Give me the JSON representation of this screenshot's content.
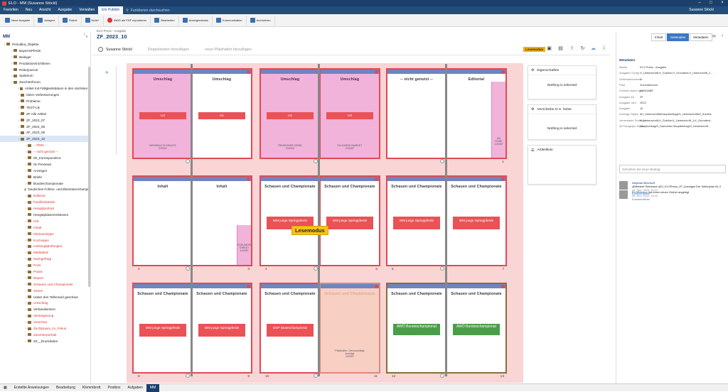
{
  "window": {
    "title": "ELO - MM (Susanne Stöckl)"
  },
  "menu": {
    "items": [
      "Favoriten",
      "Neu",
      "Ansicht",
      "Ausgabe",
      "Verwalten",
      "Elo Publish"
    ],
    "active": "Elo Publish",
    "search_placeholder": "Funktionen durchsuchen",
    "user": "Susanne Stöckl"
  },
  "ribbon": {
    "groups": [
      {
        "label": "Neue Ausgabe"
      },
      {
        "label": "Anlagen"
      },
      {
        "label": "Rubrik"
      },
      {
        "label": "Notiz+"
      },
      {
        "label": "INDD als PDF exportieren"
      },
      {
        "label": "Bearbeiten"
      },
      {
        "label": "Anzeigenstatus"
      },
      {
        "label": "Kommunikation"
      },
      {
        "label": "Archivieren"
      }
    ]
  },
  "left_panel": {
    "header": "MM",
    "tree": [
      {
        "label": "Periodika_Objekte",
        "red": false,
        "sel": false
      },
      {
        "label": "BayernsPferde",
        "red": false,
        "sel": false
      },
      {
        "label": "Beileger",
        "red": false,
        "sel": false
      },
      {
        "label": "Produktionsrichtlinien",
        "red": false,
        "sel": false
      },
      {
        "label": "Reiterjournal",
        "red": false,
        "sel": false
      },
      {
        "label": "Spektrum",
        "red": false,
        "sel": false
      },
      {
        "label": "Zuechterforum",
        "red": false,
        "sel": false
      },
      {
        "label": "Artikel mit Fälligkeitsdatum in den nächsten 2",
        "red": false,
        "sel": false
      },
      {
        "label": "Ideen Verbesserungen",
        "red": false,
        "sel": false
      },
      {
        "label": "Probleme",
        "red": false,
        "sel": false
      },
      {
        "label": "TEST-LB",
        "red": false,
        "sel": false
      },
      {
        "label": "ZF Alle Artikel",
        "red": false,
        "sel": false
      },
      {
        "label": "ZF_2023_07",
        "red": false,
        "sel": false
      },
      {
        "label": "ZF_2023_08",
        "red": false,
        "sel": false
      },
      {
        "label": "ZF_2023_09",
        "red": false,
        "sel": false
      },
      {
        "label": "ZF_2023_10",
        "red": false,
        "sel": true
      },
      {
        "label": "-- FREI --",
        "red": true,
        "sel": false
      },
      {
        "label": "-- nicht genutzt --",
        "red": true,
        "sel": false
      },
      {
        "label": "00_Korrespondenz",
        "red": false,
        "sel": false
      },
      {
        "label": "01-Previews",
        "red": false,
        "sel": false
      },
      {
        "label": "Anzeigen",
        "red": false,
        "sel": false
      },
      {
        "label": "Briefe",
        "red": false,
        "sel": false
      },
      {
        "label": "Bundeschampionate",
        "red": false,
        "sel": false
      },
      {
        "label": "Deutsches Fohlen- und Elitestutenchampio",
        "red": false,
        "sel": false
      },
      {
        "label": "Editorial",
        "red": true,
        "sel": false
      },
      {
        "label": "Familienbande",
        "red": true,
        "sel": false
      },
      {
        "label": "Hengstportrait",
        "red": true,
        "sel": false
      },
      {
        "label": "Hengstplatzierenktionen",
        "red": false,
        "sel": false
      },
      {
        "label": "HIS",
        "red": true,
        "sel": false
      },
      {
        "label": "Inhalt",
        "red": true,
        "sel": false
      },
      {
        "label": "Kleinanzeigen",
        "red": true,
        "sel": false
      },
      {
        "label": "Kurzvogen",
        "red": true,
        "sel": false
      },
      {
        "label": "Leistungsprüfungen",
        "red": true,
        "sel": false
      },
      {
        "label": "Marktplatz",
        "red": true,
        "sel": false
      },
      {
        "label": "Nachgefragt",
        "red": true,
        "sel": false
      },
      {
        "label": "Porsi",
        "red": true,
        "sel": false
      },
      {
        "label": "Praxis",
        "red": true,
        "sel": false
      },
      {
        "label": "Report",
        "red": true,
        "sel": false
      },
      {
        "label": "Schauen und Championate",
        "red": true,
        "sel": false
      },
      {
        "label": "Szene",
        "red": true,
        "sel": false
      },
      {
        "label": "Ueber den Tellerrand geschaut",
        "red": false,
        "sel": false
      },
      {
        "label": "Umschlag",
        "red": true,
        "sel": false
      },
      {
        "label": "Verbandsintern",
        "red": false,
        "sel": false
      },
      {
        "label": "Versteigerung",
        "red": true,
        "sel": false
      },
      {
        "label": "Vorschau",
        "red": true,
        "sel": false
      },
      {
        "label": "Zuchtpraxis_im_Fokus",
        "red": true,
        "sel": false
      },
      {
        "label": "Zuechterportrait",
        "red": true,
        "sel": false
      },
      {
        "label": "ZZ__Druckdaten",
        "red": false,
        "sel": false
      }
    ]
  },
  "main": {
    "breadcrumb": "ELO Press - Ausgabe",
    "title": "ZF_2023_10",
    "user": "Susanne Stöckl",
    "dropdown1": "Doppelseiten hinzufügen",
    "dropdown2": "neue Platzhalter hinzufügen",
    "lesemodus_badge": "Lesemodus",
    "lesemodus_label": "Lesemodus"
  },
  "pages": {
    "p1a": {
      "title": "Umschlag",
      "box": "U4",
      "mini": "WEIHRAUCH KRAUTE\n2/4/287"
    },
    "p1b": {
      "title": "Umschlag",
      "box": "U1"
    },
    "p2a": {
      "title": "Umschlag",
      "box": "U2",
      "mini": "TRAKEHNER VEREL\n2/4/430"
    },
    "p2b": {
      "title": "Umschlag",
      "box": "U3",
      "mini": "EN GARDE MARKET\n2/4/287"
    },
    "p3a": {
      "title": "-- nicht genutzt --"
    },
    "p3b": {
      "title": "Editorial",
      "mini": "HH\nFAIRE\n1/4/287",
      "num": "1"
    },
    "p4a": {
      "title": "Inhalt",
      "num": "2"
    },
    "p4b": {
      "title": "Inhalt",
      "mini": "EDELWEISS\nDIRKE?\n1/4/287",
      "num": "3"
    },
    "p5a": {
      "title": "Schauen und Championate",
      "box": "WM junge Springpferde",
      "num": "4"
    },
    "p5b": {
      "title": "Schauen und Championate",
      "box": "WM junge Springpferde",
      "num": "5"
    },
    "p6a": {
      "title": "Schauen und Championate",
      "box": "WM junge Springpferde",
      "num": "6"
    },
    "p6b": {
      "title": "Schauen und Championate",
      "box": "WM junge Springpferde",
      "num": "7"
    },
    "p7a": {
      "title": "Schauen und Championate",
      "box": "WM junge Springpferde",
      "num": "8"
    },
    "p7b": {
      "title": "Schauen und Championate",
      "box": "WM junge Springpferde",
      "num": "9"
    },
    "p8a": {
      "title": "Schauen und Championate",
      "box": "DSP Stutenchampionat",
      "num": "10"
    },
    "p8b": {
      "title": "Schauen und Championate",
      "mini": "Platzhalter: Genussmittge\nAnzeige\n1/4/287",
      "num": "11"
    },
    "p9a": {
      "title": "Schauen und Championate",
      "green": "AWÖ Bundeschampionat",
      "num": "12"
    },
    "p9b": {
      "title": "Schauen und Championate",
      "green": "AWÖ Bundeschampionat",
      "num": "13"
    }
  },
  "right_cards": {
    "card1_title": "Eigenschaften",
    "card1_body": "Nothing is selected",
    "card2_title": "Verschiebe D.S. hinter",
    "card2_body": "Nothing is selected",
    "card3_title": "Artikelliste"
  },
  "meta": {
    "tabs": [
      "Inhalt",
      "Seitenplan",
      "Metadaten"
    ],
    "active_tab": "Seitenplan",
    "title": "Metadaten",
    "rows": [
      {
        "k": "Maske",
        "v": "ELO Press - Ausgabe"
      },
      {
        "k": "Ausgabe Config",
        "v": "H_Ueberschrift,H_Subline,H_Grundtext,H_Ueberschrift_2..."
      },
      {
        "k": "Seitenstartnummer",
        "v": "1"
      },
      {
        "k": "Pfad",
        "v": "Zuechterforum"
      },
      {
        "k": "Solution object type",
        "v": "AUSGABE"
      },
      {
        "k": "Ausgabe Art",
        "v": "ZF"
      },
      {
        "k": "Ausgabe Jahr",
        "v": "2023"
      },
      {
        "k": "Ausgabe",
        "v": "10"
      },
      {
        "k": "InDesign Styles",
        "v": "#H_Ueberschrift#Hauptbeitrag#H_Ueberschrift#H_Subline"
      },
      {
        "k": "Verwendete Textfelde",
        "v": "H_Ueberschrift,H_Subline,K_Ueberschrift_1,K_Grundtext..."
      },
      {
        "k": "All Paragraph Styles",
        "v": "Hauptbeitrag/H_Dachzeile,Hauptbeitrag/H_Ueberschrift..."
      }
    ],
    "comment_placeholder": "Schreiben Sie einen Beitrag",
    "comments": [
      {
        "name": "Stephan Bischoff",
        "text": "@Melanie Steinbach @G_ELOPress_ZF_Anzeigen Der Seitenplan für Z",
        "date": "14. Sep. 2023, 11:22",
        "link": "Kommentieren"
      },
      {
        "name": "ELOService",
        "text": "hat einen neuen Ordner angelegt",
        "date": "28. Nov. 2022, 14:33",
        "link": "Kommentieren"
      }
    ]
  },
  "statusbar": {
    "items": [
      "Erstellte Anweisungen",
      "Bearbeitung",
      "Klemmbrett",
      "Postbox",
      "Aufgaben",
      "MM"
    ],
    "active": "MM"
  }
}
